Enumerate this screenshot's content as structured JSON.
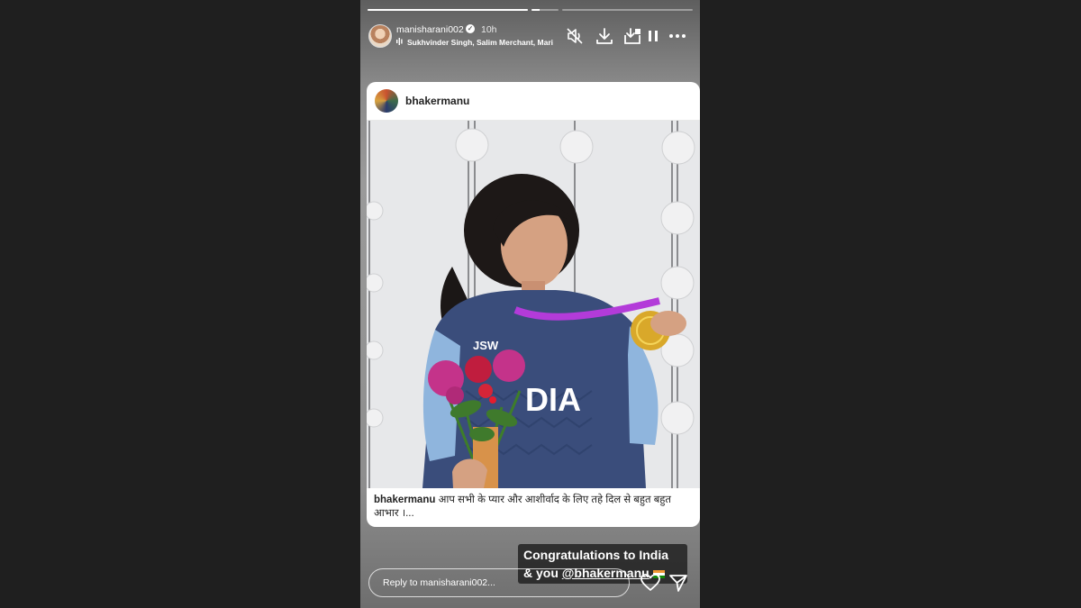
{
  "story": {
    "progress": [
      1,
      0.3,
      0
    ],
    "user": {
      "name": "manisharani002",
      "time": "10h"
    },
    "music": "Sukhvinder Singh, Salim Merchant, Mari",
    "icons": [
      "mute-icon",
      "download-icon",
      "save-icon",
      "pause-icon",
      "more-icon"
    ]
  },
  "post": {
    "username": "bhakermanu",
    "caption_user": "bhakermanu",
    "caption_text": "आप सभी के प्यार और आशीर्वाद के लिए तहे दिल से बहुत बहुत आभार ।...",
    "jersey_text": "DIA",
    "jersey_sponsor": "JSW"
  },
  "sticker": {
    "line1": "Congratulations to India",
    "line2_prefix": "& you ",
    "line2_handle": "@bhakermanu"
  },
  "reply": {
    "placeholder": "Reply to manisharani002..."
  }
}
